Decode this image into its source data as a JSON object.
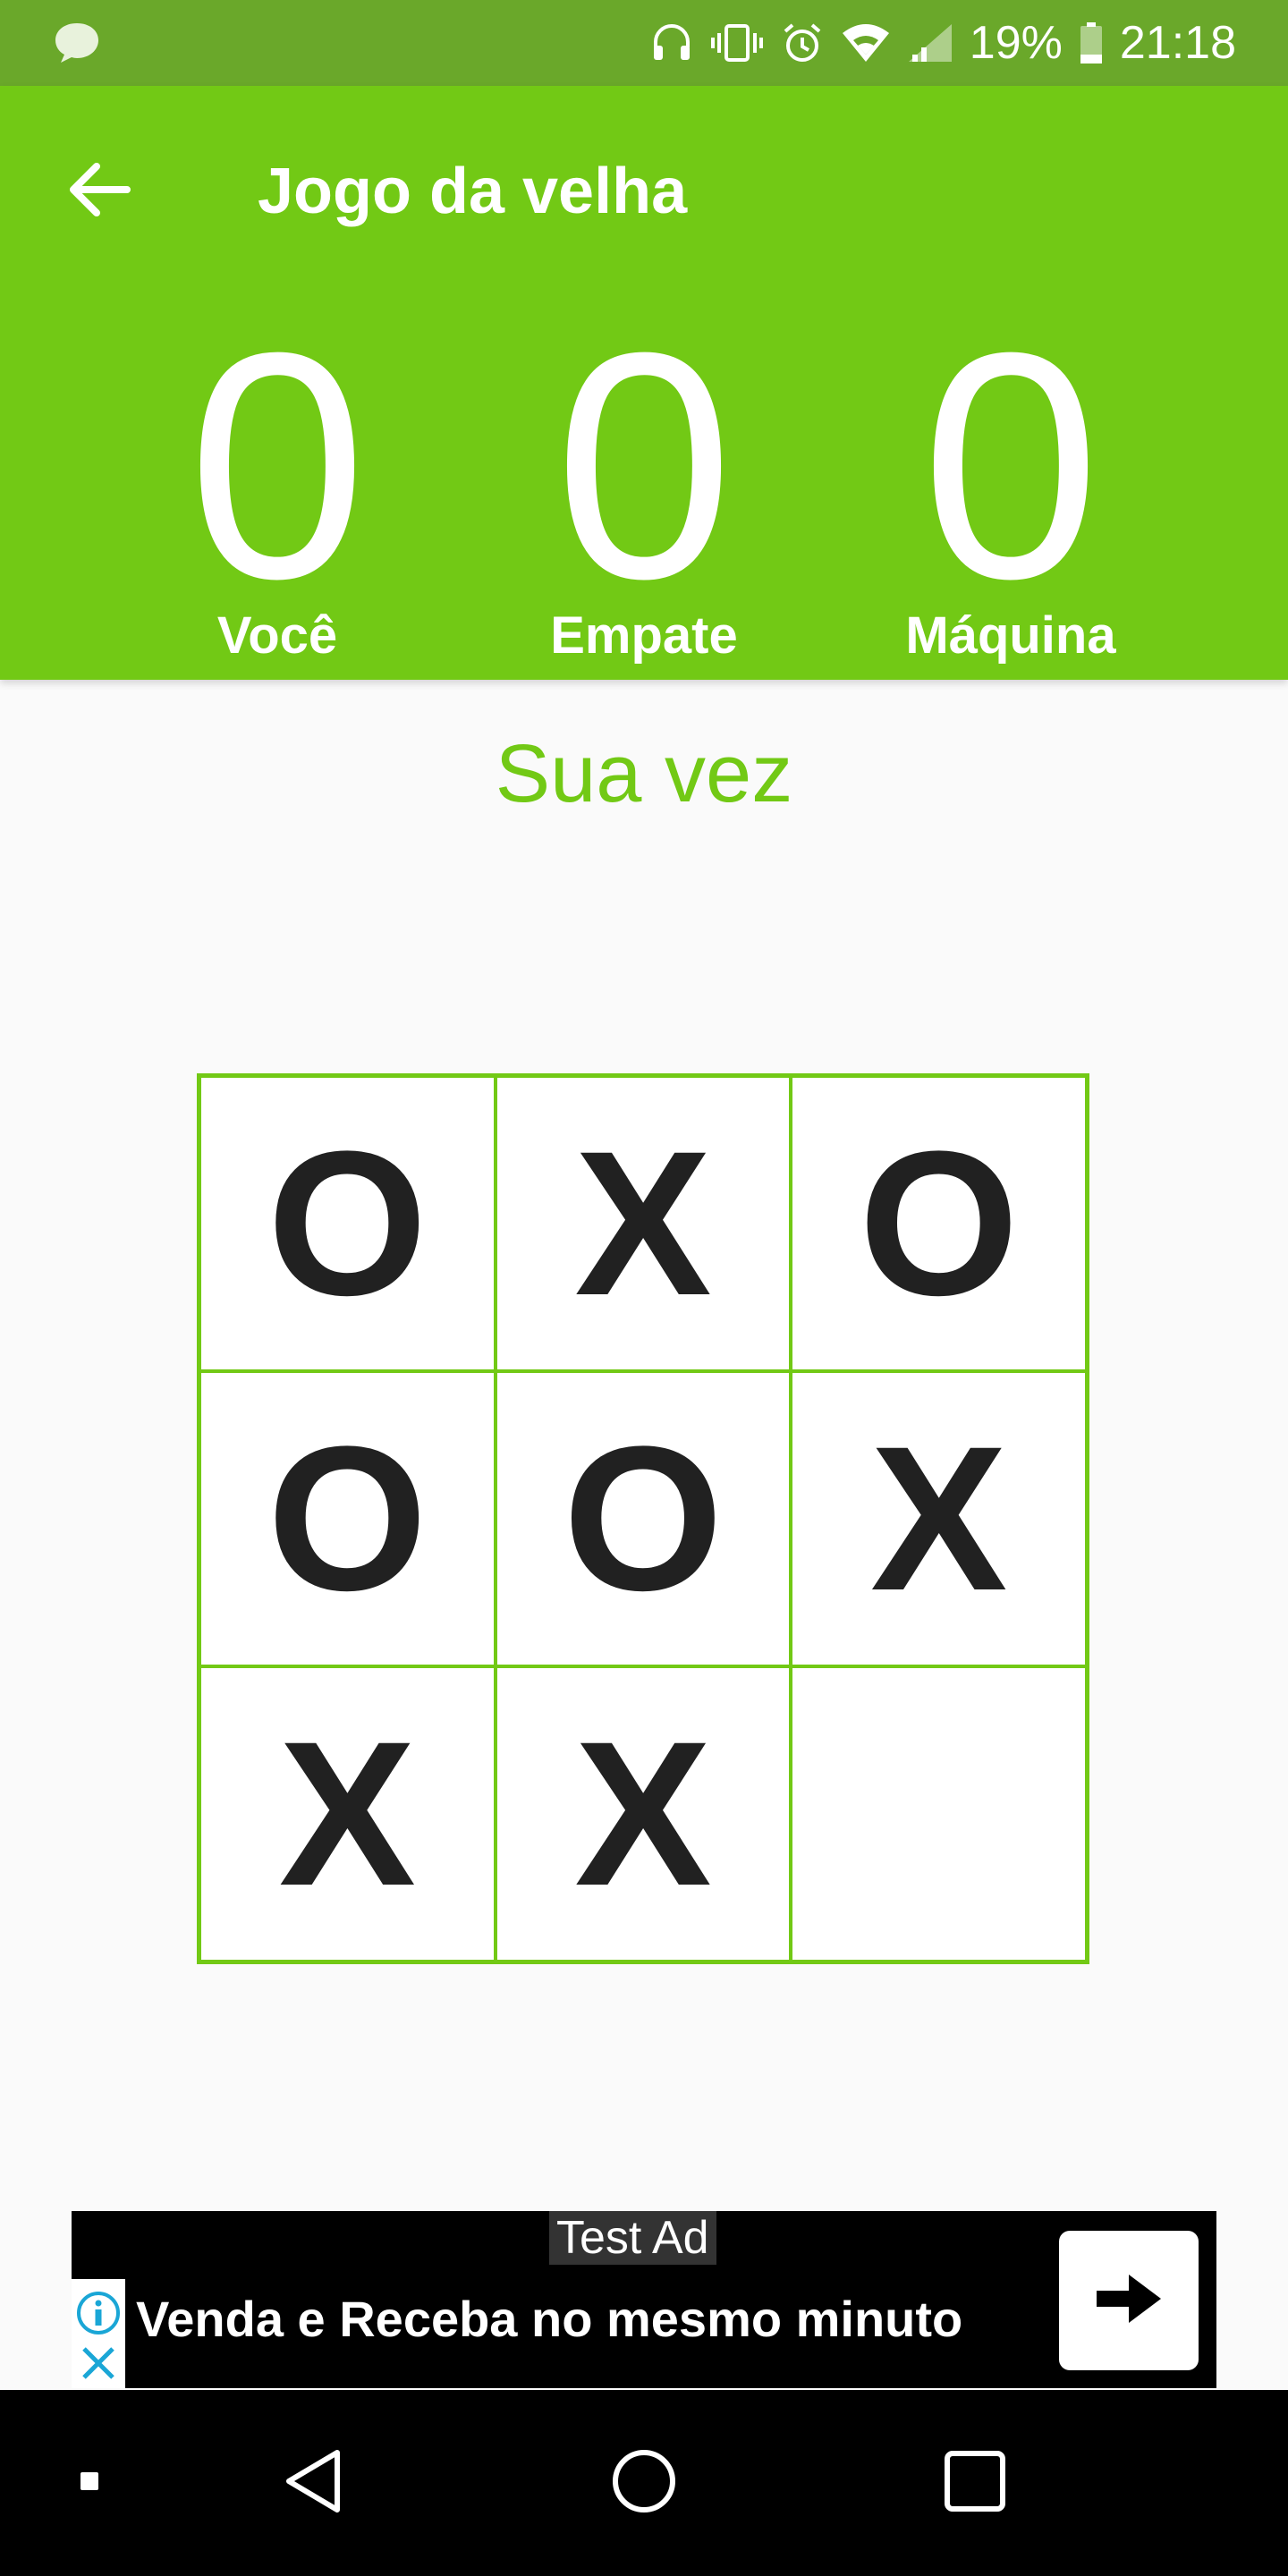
{
  "status_bar": {
    "battery": "19%",
    "time": "21:18",
    "icons": [
      "chat-bubble-icon",
      "headset-icon",
      "vibrate-icon",
      "alarm-icon",
      "wifi-icon",
      "signal-icon",
      "battery-icon"
    ]
  },
  "app_bar": {
    "title": "Jogo da velha",
    "back_icon": "arrow-back-icon"
  },
  "scores": [
    {
      "value": "0",
      "label": "Você"
    },
    {
      "value": "0",
      "label": "Empate"
    },
    {
      "value": "0",
      "label": "Máquina"
    }
  ],
  "turn_text": "Sua vez",
  "board": {
    "cells": [
      "O",
      "X",
      "O",
      "O",
      "O",
      "X",
      "X",
      "X",
      ""
    ]
  },
  "ad": {
    "label": "Test Ad",
    "headline": "Venda e Receba no mesmo minuto",
    "cta_icon": "arrow-right-icon"
  },
  "nav_bar": {
    "buttons": [
      "square-dot-icon",
      "back-triangle-icon",
      "home-circle-icon",
      "recents-square-icon"
    ]
  },
  "colors": {
    "primary": "#72c915",
    "status_bar": "#6aa82a",
    "background": "#fafafa",
    "mark": "#212121"
  }
}
